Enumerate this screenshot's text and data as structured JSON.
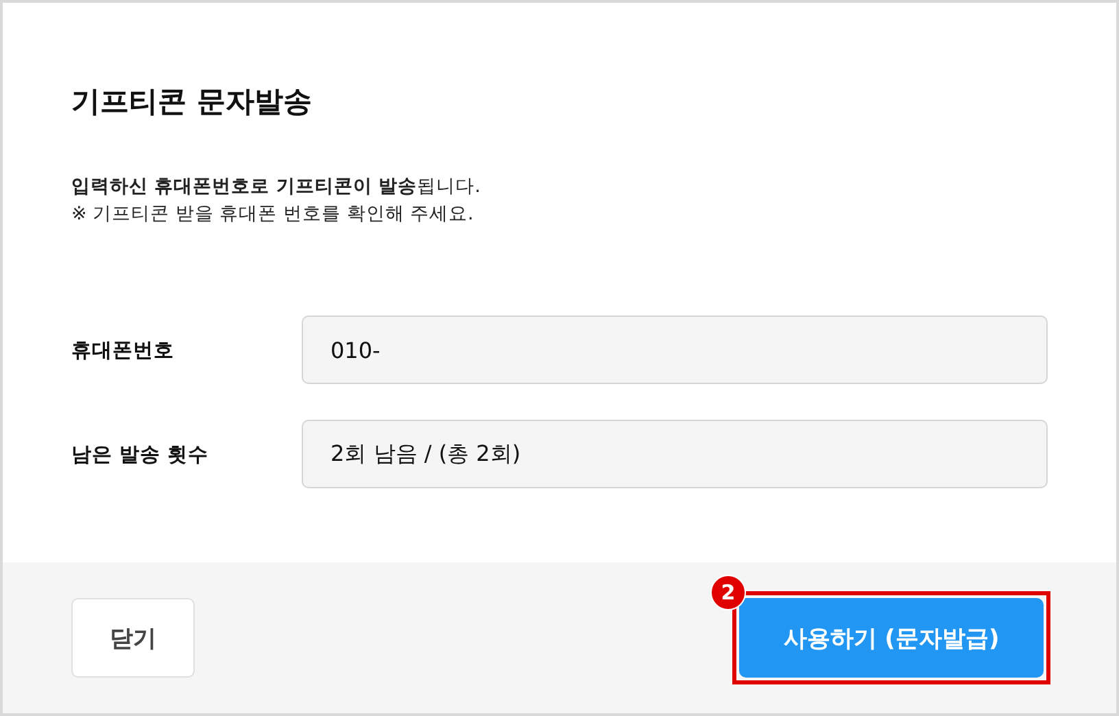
{
  "dialog": {
    "title": "기프티콘 문자발송",
    "notice": [
      "**입력하신 휴대폰번호로 기프티콘이 발송**됩니다.",
      "※ 기프티콘 받을 휴대폰 번호를 확인해 주세요."
    ],
    "fields": [
      {
        "label": "휴대폰번호",
        "value": "010-"
      },
      {
        "label": "남은 발송 횟수",
        "value": "2회 남음 / (총 2회)"
      }
    ],
    "buttons": [
      {
        "label": "닫기",
        "kind": "secondary"
      },
      {
        "label": "사용하기 (문자발급)",
        "kind": "primary",
        "callout": "2"
      }
    ]
  }
}
